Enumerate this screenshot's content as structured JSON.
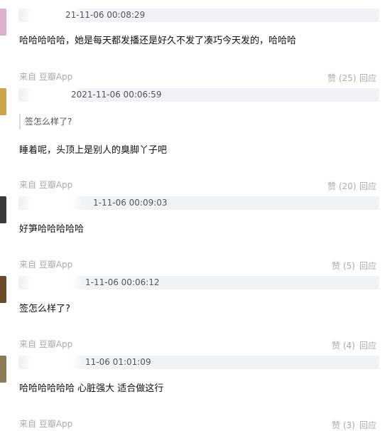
{
  "source_prefix": "来自",
  "source_app": "豆瓣App",
  "like_label": "赞",
  "reply_label": "回应",
  "comments": [
    {
      "timestamp": "21-11-06 00:08:29",
      "quote": "",
      "text": "哈哈哈哈哈，她是每天都发播还是好久不发了凑巧今天发的，哈哈哈",
      "likes": "(25)",
      "avatar_color": "#d9b0cf"
    },
    {
      "timestamp": "2021-11-06 00:06:59",
      "quote": "签怎么样了?",
      "text": "睡着呢，头顶上是别人的臭脚丫子吧",
      "likes": "(20)",
      "avatar_color": "#c9a44a"
    },
    {
      "timestamp": "1-11-06 00:09:03",
      "quote": "",
      "text": "好笋哈哈哈哈哈",
      "likes": "(5)",
      "avatar_color": "#3a3a3a"
    },
    {
      "timestamp": "1-11-06 00:06:12",
      "quote": "",
      "text": "签怎么样了?",
      "likes": "(4)",
      "avatar_color": "#6b4a2a"
    },
    {
      "timestamp": "11-06 01:01:09",
      "quote": "",
      "text": "哈哈哈哈哈哈 心脏强大 适合做这行",
      "likes": "(3)",
      "avatar_color": "#8a7a55"
    }
  ]
}
